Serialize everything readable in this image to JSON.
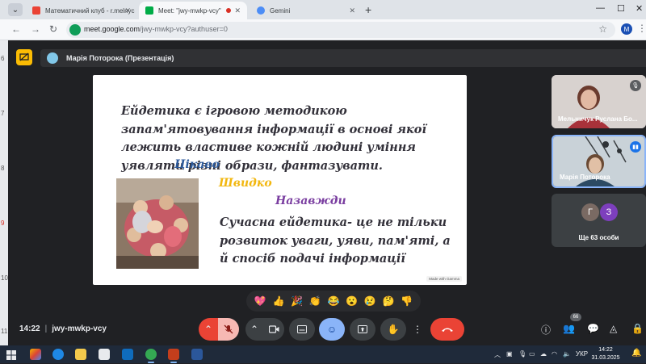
{
  "browser": {
    "tabs": [
      {
        "title": "Математичний клуб - r.melnyc",
        "active": false
      },
      {
        "title": "Meet: \"jwy-mwkp-vcy\"",
        "active": true
      },
      {
        "title": "Gemini",
        "active": false
      }
    ],
    "address_domain": "meet.google.com",
    "address_path": "/jwy-mwkp-vcy?authuser=0",
    "profile_initial": "M"
  },
  "left_strip_numbers": [
    "6",
    "7",
    "8",
    "9",
    "10",
    "11"
  ],
  "meet": {
    "presenter_label": "Марія Поторока (Презентація)",
    "slide": {
      "paragraph1": "Ейдетика є ігровою методикою запам'ятовування інформації в основі якої лежить властиве кожній людині уміння уявляти різні образи, фантазувати.",
      "word1": "Цікаво",
      "word2": "Швидко",
      "word3": "Назавжди",
      "paragraph2": "Сучасна ейдетика- це не тільки розвиток уваги, уяви, пам'яті, а й спосіб подачі інформації",
      "badge": "Made with Gamma"
    },
    "participants": [
      {
        "name": "Мельничук Руслана Бо..."
      },
      {
        "name": "Марія Поторока"
      }
    ],
    "others": {
      "initials": [
        "Г",
        "З"
      ],
      "label": "Ще 63 особи"
    },
    "reactions": [
      "💖",
      "👍",
      "🎉",
      "👏",
      "😂",
      "😮",
      "😢",
      "🤔",
      "👎"
    ],
    "time": "14:22",
    "meeting_code": "jwy-mwkp-vcy",
    "participant_count": "66"
  },
  "taskbar": {
    "lang": "УКР",
    "time": "14:22",
    "date": "31.03.2025"
  },
  "colors": {
    "word1": "#2c5a9c",
    "word2": "#f2b70f",
    "word3": "#7a3ea0",
    "end_call": "#ea4335",
    "present_button": "#fbbc04"
  }
}
